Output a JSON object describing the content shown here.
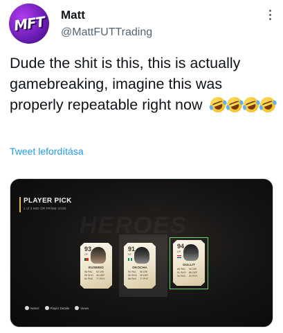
{
  "tweet": {
    "author_name": "Matt",
    "author_handle": "@MattFUTTrading",
    "avatar_text": "MFT",
    "text": "Dude the shit is this, this is actually gamebreaking, imagine this was properly repeatable right now",
    "emoji": [
      "rolling-on-floor-laughing",
      "rolling-on-floor-laughing",
      "rolling-on-floor-laughing",
      "rolling-on-floor-laughing"
    ],
    "translate_label": "Tweet lefordítása",
    "accent_color": "#1d9bf0"
  },
  "media": {
    "title": "PLAYER PICK",
    "subtitle": "1 of 3 MID OR PRIME ICON",
    "bg_text": "HEROES",
    "cards": [
      {
        "rating": "93",
        "position": "CF",
        "name": "EUSEBIO",
        "stats": [
          "96 PAC",
          "92 DRI",
          "95 SHO",
          "45 DEF",
          "81 PAS",
          "77 PHY"
        ]
      },
      {
        "rating": "91",
        "position": "ST",
        "name": "OKOCHA",
        "stats": [
          "90 PAC",
          "96 DRI",
          "85 SHO",
          "39 DEF",
          "88 PAS",
          "77 PHY"
        ]
      },
      {
        "rating": "94",
        "position": "CF",
        "name": "GULLIT",
        "stats": [
          "86 PAC",
          "90 DRI",
          "91 SHO",
          "86 DEF",
          "90 PAS",
          "92 PHY"
        ]
      }
    ],
    "controls": [
      {
        "icon": "a-button-icon",
        "label": "Select"
      },
      {
        "icon": "stick-icon",
        "label": "Player Details"
      },
      {
        "icon": "x-button-icon",
        "label": "Views"
      }
    ]
  }
}
